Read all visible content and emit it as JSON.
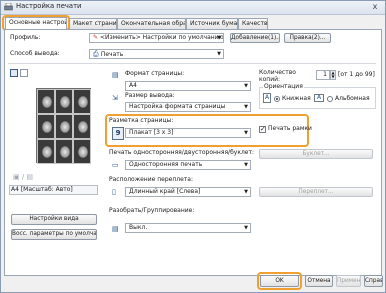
{
  "window": {
    "title": "Настройка печати",
    "close_glyph": "x"
  },
  "tabs": [
    {
      "label": "Основные настройки"
    },
    {
      "label": "Макет страницы"
    },
    {
      "label": "Окончательная обработка"
    },
    {
      "label": "Источник бумаги"
    },
    {
      "label": "Качество"
    }
  ],
  "profile": {
    "label": "Профиль:",
    "value": "<Изменить> Настройки по умолчанию",
    "add_button": "Добавление(1)...",
    "edit_button": "Правка(2)..."
  },
  "output_method": {
    "label": "Способ вывода:",
    "value": "Печать"
  },
  "page_size": {
    "label": "Формат страницы:",
    "value": "A4"
  },
  "output_size": {
    "label": "Размер вывода:",
    "value": "Настройка формата страницы"
  },
  "copies": {
    "label": "Количество копий:",
    "value": "1",
    "range": "[от 1 до 99]"
  },
  "orientation": {
    "label": "Ориентация",
    "portrait": "Книжная",
    "landscape": "Альбомная",
    "selected": "portrait"
  },
  "page_layout": {
    "label": "Разметка страницы:",
    "value": "Плакат [3 x 3]",
    "icon_text": "9"
  },
  "print_borders": {
    "label": "Печать рамки",
    "checked": true
  },
  "duplex": {
    "label": "Печать односторонняя/двусторонняя/буклет:",
    "value": "Односторонняя печать",
    "button": "Буклет..."
  },
  "binding": {
    "label": "Расположение переплета:",
    "value": "Длинный край [Слева]",
    "button": "Переплет..."
  },
  "collate": {
    "label": "Разобрать/Группирование:",
    "value": "Выкл."
  },
  "preview": {
    "caption": "A4 [Масштаб: Авто]"
  },
  "left_buttons": {
    "view_settings": "Настройки вида",
    "restore_defaults": "Восс. параметры по умолчанию"
  },
  "footer": {
    "ok": "OK",
    "cancel": "Отмена",
    "apply": "Применить",
    "help": "Справка"
  },
  "colors": {
    "highlight": "#f0a030",
    "accent": "#1b4f8c"
  }
}
